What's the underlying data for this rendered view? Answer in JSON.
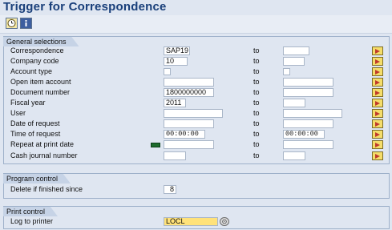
{
  "title": "Trigger for Correspondence",
  "toolbar": {
    "execute_icon": "execute-clock-icon",
    "info_icon": "info-icon"
  },
  "groups": {
    "general": "General selections",
    "program": "Program control",
    "print": "Print control"
  },
  "to_label": "to",
  "rows": [
    {
      "label": "Correspondence",
      "from": "SAP19",
      "to": ""
    },
    {
      "label": "Company code",
      "from": "10",
      "to": ""
    },
    {
      "label": "Account type",
      "from": "",
      "to": ""
    },
    {
      "label": "Open item account",
      "from": "",
      "to": ""
    },
    {
      "label": "Document number",
      "from": "1800000000",
      "to": ""
    },
    {
      "label": "Fiscal year",
      "from": "2011",
      "to": ""
    },
    {
      "label": "User",
      "from": "",
      "to": ""
    },
    {
      "label": "Date of request",
      "from": "",
      "to": ""
    },
    {
      "label": "Time of request",
      "from": "00:00:00",
      "to": "00:00:00"
    },
    {
      "label": "Repeat at print date",
      "from": "",
      "to": ""
    },
    {
      "label": "Cash journal number",
      "from": "",
      "to": ""
    }
  ],
  "program_control": {
    "label": "Delete if finished since",
    "value": "8"
  },
  "print_control": {
    "label": "Log to printer",
    "value": "LOCL"
  }
}
